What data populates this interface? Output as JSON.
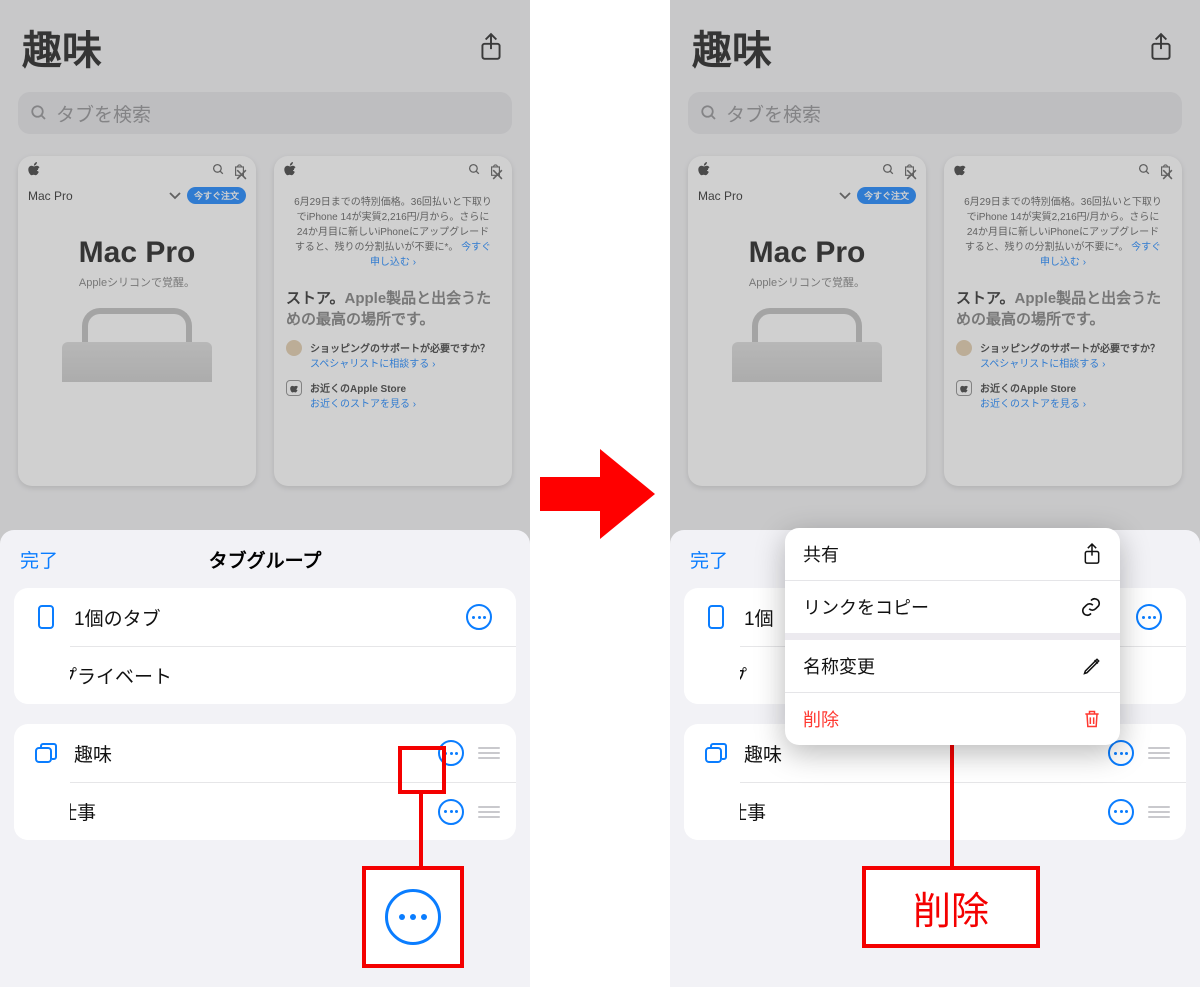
{
  "left": {
    "title": "趣味",
    "search_placeholder": "タブを検索",
    "tab1": {
      "nav_label": "Mac Pro",
      "order_pill": "今すぐ注文",
      "headline": "Mac Pro",
      "subline": "Appleシリコンで覚醒。"
    },
    "tab2": {
      "promo": "6月29日までの特別価格。36回払いと下取りでiPhone 14が実質2,216円/月から。さらに24か月目に新しいiPhoneにアップグレードすると、残りの分割払いが不要に*。",
      "promo_link": "今すぐ申し込む ›",
      "store_h_bold": "ストア。",
      "store_h_rest": "Apple製品と出会うための最高の場所です。",
      "bullet1_title": "ショッピングのサポートが必要ですか？",
      "bullet1_link": "スペシャリストに相談する ›",
      "bullet2_title": "お近くのApple Store",
      "bullet2_link": "お近くのストアを見る ›"
    },
    "sheet": {
      "done": "完了",
      "title": "タブグループ",
      "row_tabs": "1個のタブ",
      "row_private": "プライベート",
      "group1": "趣味",
      "group2": "仕事"
    }
  },
  "right": {
    "title": "趣味",
    "search_placeholder": "タブを検索",
    "sheet": {
      "done": "完了"
    },
    "row_tabs_trunc": "1個",
    "row_private_trunc": "プ",
    "group1": "趣味",
    "group2": "仕事",
    "ctx": {
      "share": "共有",
      "copy": "リンクをコピー",
      "rename": "名称変更",
      "delete": "削除"
    },
    "callout": "削除"
  }
}
